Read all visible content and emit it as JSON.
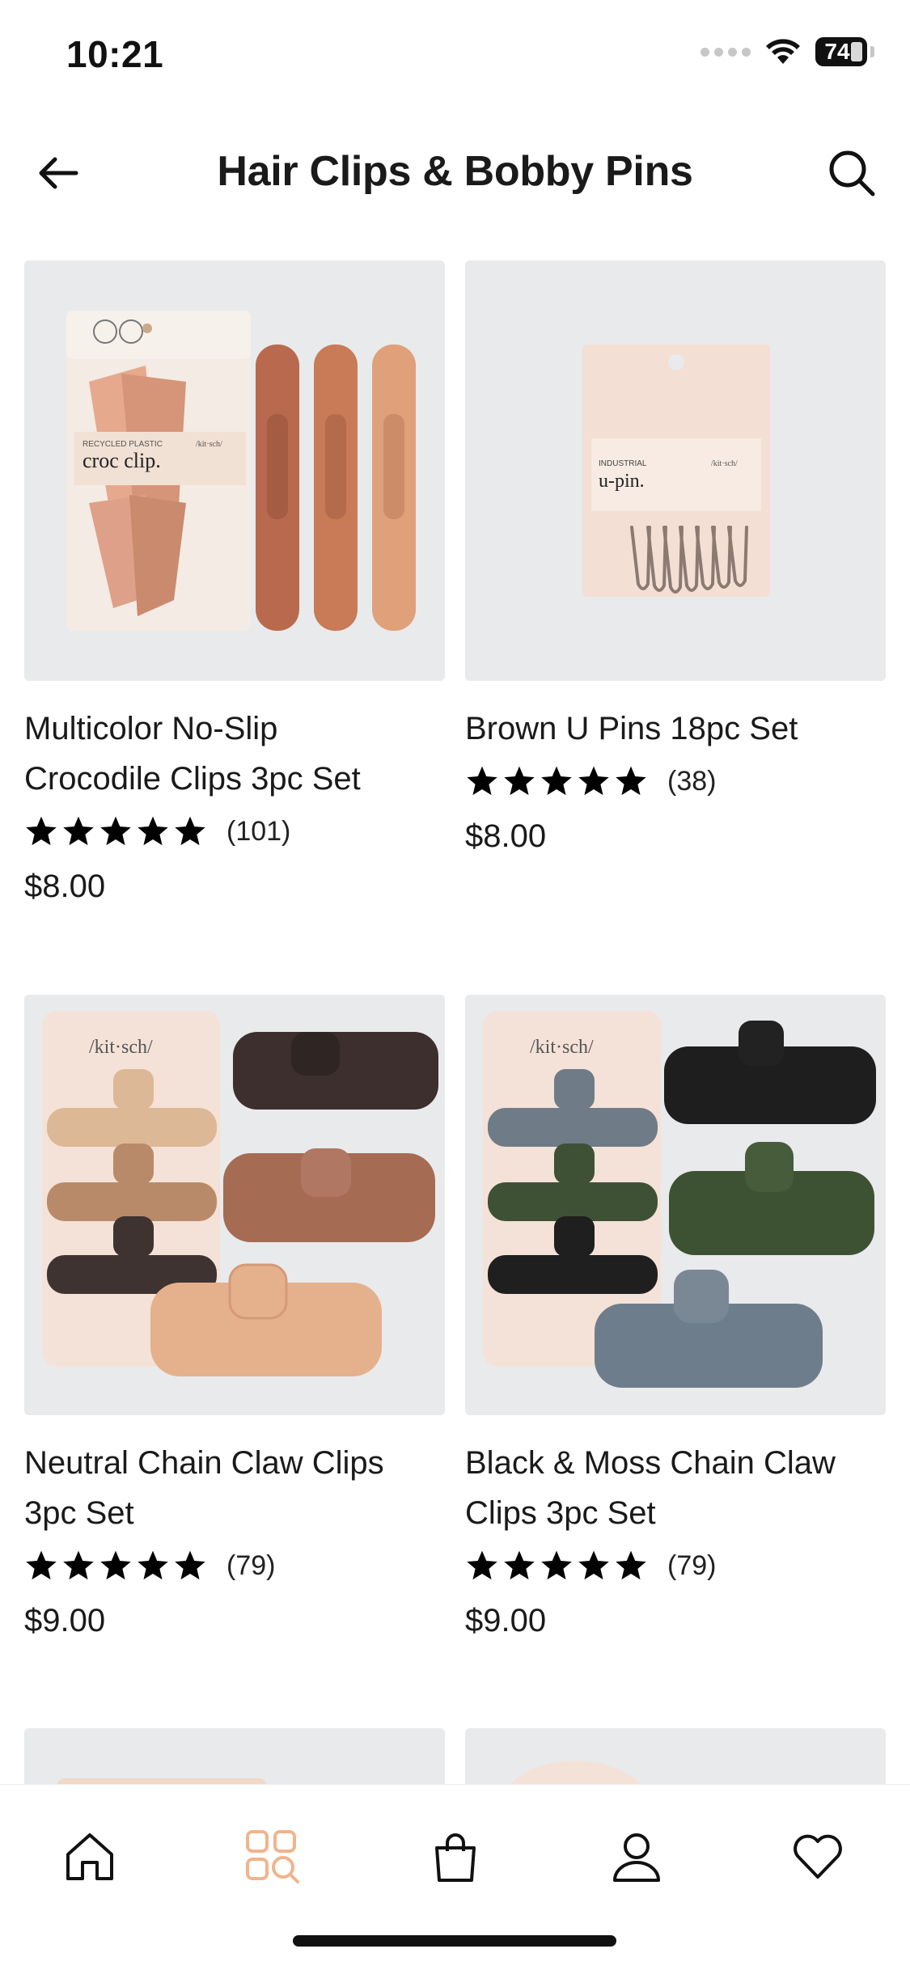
{
  "status_bar": {
    "time": "10:21",
    "battery": "74"
  },
  "header": {
    "title": "Hair Clips & Bobby Pins",
    "back_icon": "arrow-left-icon",
    "search_icon": "search-icon"
  },
  "products": [
    {
      "name_line1": "Multicolor No-Slip",
      "name_line2": "Crocodile Clips 3pc Set",
      "rating": 5,
      "reviews": "(101)",
      "price": "$8.00"
    },
    {
      "name_line1": "Brown U Pins 18pc Set",
      "name_line2": "",
      "rating": 5,
      "reviews": "(38)",
      "price": "$8.00"
    },
    {
      "name_line1": "Neutral Chain Claw Clips",
      "name_line2": "3pc Set",
      "rating": 5,
      "reviews": "(79)",
      "price": "$9.00"
    },
    {
      "name_line1": "Black & Moss Chain Claw",
      "name_line2": "Clips 3pc Set",
      "rating": 5,
      "reviews": "(79)",
      "price": "$9.00"
    }
  ],
  "packaging_text": {
    "croc_small": "RECYCLED PLASTIC",
    "croc_big": "croc clip.",
    "brand": "/kit·sch/",
    "upin_small": "INDUSTRIAL",
    "upin_big": "u-pin."
  },
  "tab_bar": {
    "items": [
      {
        "name": "home",
        "icon": "home-icon",
        "active": false
      },
      {
        "name": "shop",
        "icon": "shop-search-icon",
        "active": true
      },
      {
        "name": "bag",
        "icon": "shopping-bag-icon",
        "active": false
      },
      {
        "name": "account",
        "icon": "person-icon",
        "active": false
      },
      {
        "name": "wishlist",
        "icon": "heart-icon",
        "active": false
      }
    ]
  },
  "colors": {
    "accent_active": "#f0b48c",
    "text": "#1a1a1a",
    "image_bg": "#e9eaec"
  }
}
